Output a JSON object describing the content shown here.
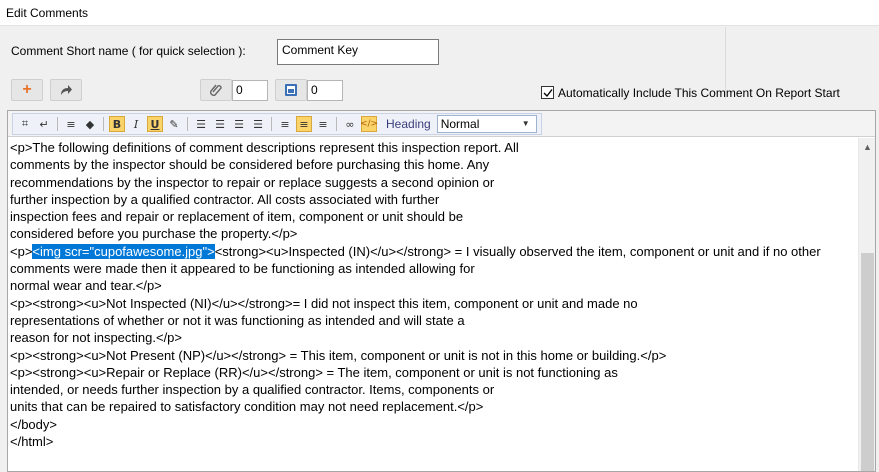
{
  "window": {
    "title": "Edit Comments"
  },
  "short_name": {
    "label": "Comment Short name ( for quick selection ):",
    "value": "Comment Key"
  },
  "toolbar_top": {
    "attach_count": "0",
    "photo_count": "0",
    "auto_include_label": "Automatically Include This Comment On Report Start",
    "auto_include_checked": true
  },
  "editor_toolbar": {
    "heading_label": "Heading",
    "heading_value": "Normal"
  },
  "editor": {
    "lines": [
      "<p>The following definitions of comment descriptions represent this inspection report. All",
      "comments by the inspector should be considered before purchasing this home. Any",
      "recommendations by the inspector to repair or replace suggests a second opinion or",
      "further inspection by a qualified contractor. All costs associated with further",
      "inspection fees and repair or replacement of item, component or unit should be",
      "considered before you purchase the property.</p>"
    ],
    "line7_prefix": "<p>",
    "line7_selected": "<img scr=\"cupofawesome.jpg\">",
    "line7_rest": "<strong><u>Inspected (IN)</u></strong> = I visually observed the item, component or unit and if no other",
    "lines_after": [
      "comments were made then it appeared to be functioning as intended allowing for",
      "normal wear and tear.</p>",
      "<p><strong><u>Not Inspected (NI)</u></strong>= I did not inspect this item, component or unit and made no",
      "representations of whether or not it was functioning as intended and will state a",
      "reason for not inspecting.</p>",
      "<p><strong><u>Not Present (NP)</u></strong> = This item, component or unit is not in this home or building.</p>",
      "<p><strong><u>Repair or Replace (RR)</u></strong> = The item, component or unit is not functioning as",
      "intended, or needs further inspection by a qualified contractor. Items, components or",
      "units that can be repaired to satisfactory condition may not need replacement.</p>",
      "</body>",
      "</html>"
    ]
  },
  "colors": {
    "selection": "#0078d7",
    "add_icon": "#e8742c",
    "active_tool": "#fbd36b"
  }
}
